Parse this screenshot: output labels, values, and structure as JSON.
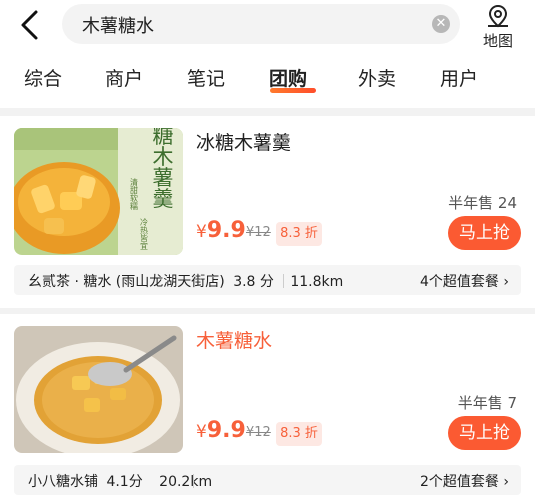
{
  "search": {
    "query": "木薯糖水"
  },
  "map": {
    "label": "地图"
  },
  "tabs": [
    "综合",
    "商户",
    "笔记",
    "团购",
    "外卖",
    "用户"
  ],
  "deals": [
    {
      "title": "冰糖木薯羹",
      "sold": "半年售 24",
      "price_symbol": "¥",
      "price": "9.9",
      "original": "¥12",
      "discount": "8.3 折",
      "buy": "马上抢",
      "shop": "幺贰茶 · 糖水 (雨山龙湖天街店)",
      "rating": "3.8 分",
      "distance": "11.8km",
      "packages": "4个超值套餐",
      "image_text": {
        "big": "冰糖木薯羹",
        "small1": "清甜软糯",
        "small2": "冷热皆宜"
      }
    },
    {
      "title": "木薯糖水",
      "sold": "半年售 7",
      "price_symbol": "¥",
      "price": "9.9",
      "original": "¥12",
      "discount": "8.3 折",
      "buy": "马上抢",
      "shop": "小八糖水铺",
      "rating": "4.1分",
      "distance": "20.2km",
      "packages": "2个超值套餐"
    }
  ],
  "colors": {
    "accent": "#f7603a",
    "button": "#fb5a32"
  },
  "icons": [
    "back-arrow-icon",
    "clear-icon",
    "map-pin-icon",
    "chevron-right-icon"
  ]
}
